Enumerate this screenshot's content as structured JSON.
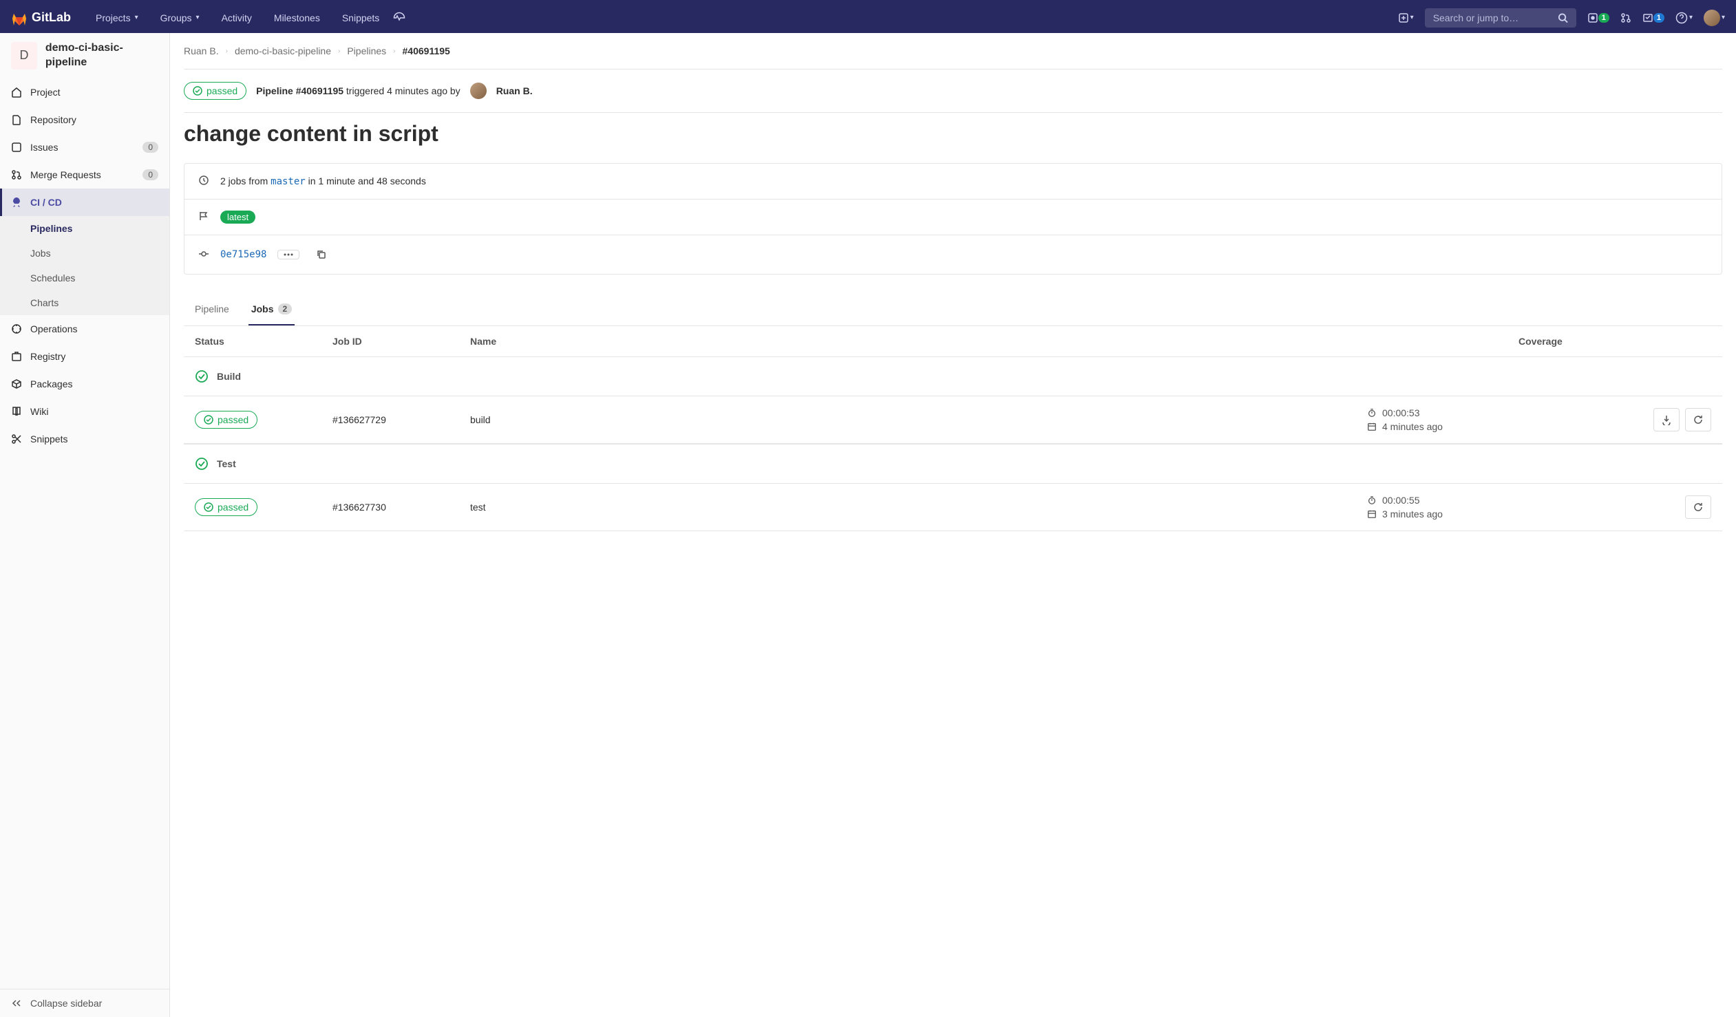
{
  "nav": {
    "brand": "GitLab",
    "items": [
      "Projects",
      "Groups",
      "Activity",
      "Milestones",
      "Snippets"
    ],
    "search_placeholder": "Search or jump to…",
    "issues_badge": "1",
    "todos_badge": "1"
  },
  "sidebar": {
    "project_initial": "D",
    "project_name": "demo-ci-basic-pipeline",
    "items": [
      {
        "label": "Project"
      },
      {
        "label": "Repository"
      },
      {
        "label": "Issues",
        "badge": "0"
      },
      {
        "label": "Merge Requests",
        "badge": "0"
      },
      {
        "label": "CI / CD",
        "active": true,
        "sub": [
          {
            "label": "Pipelines",
            "active": true
          },
          {
            "label": "Jobs"
          },
          {
            "label": "Schedules"
          },
          {
            "label": "Charts"
          }
        ]
      },
      {
        "label": "Operations"
      },
      {
        "label": "Registry"
      },
      {
        "label": "Packages"
      },
      {
        "label": "Wiki"
      },
      {
        "label": "Snippets"
      }
    ],
    "collapse": "Collapse sidebar"
  },
  "breadcrumb": [
    "Ruan B.",
    "demo-ci-basic-pipeline",
    "Pipelines",
    "#40691195"
  ],
  "summary": {
    "status": "passed",
    "pipeline_label": "Pipeline #40691195",
    "triggered_text": "triggered 4 minutes ago by",
    "user": "Ruan B."
  },
  "title": "change content in script",
  "info": {
    "jobs_prefix": "2 jobs from ",
    "branch": "master",
    "jobs_suffix": " in 1 minute and 48 seconds",
    "tag": "latest",
    "commit_sha": "0e715e98"
  },
  "tabs": {
    "pipeline": "Pipeline",
    "jobs": "Jobs",
    "jobs_count": "2"
  },
  "table": {
    "headers": [
      "Status",
      "Job ID",
      "Name",
      "",
      "",
      "Coverage",
      ""
    ],
    "stages": [
      {
        "name": "Build",
        "jobs": [
          {
            "status": "passed",
            "id": "#136627729",
            "name": "build",
            "duration": "00:00:53",
            "finished": "4 minutes ago",
            "download": true
          }
        ]
      },
      {
        "name": "Test",
        "jobs": [
          {
            "status": "passed",
            "id": "#136627730",
            "name": "test",
            "duration": "00:00:55",
            "finished": "3 minutes ago",
            "download": false
          }
        ]
      }
    ]
  }
}
